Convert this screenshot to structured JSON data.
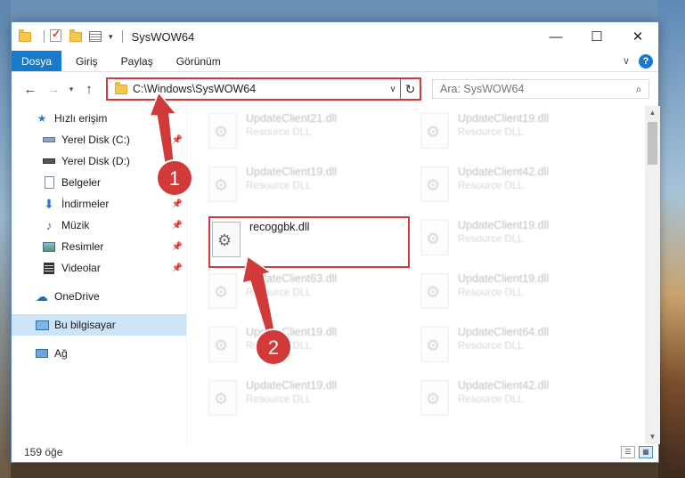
{
  "window": {
    "title": "SysWOW64",
    "minimize_glyph": "—",
    "maximize_glyph": "☐",
    "close_glyph": "✕"
  },
  "ribbon": {
    "file_tab": "Dosya",
    "tabs": [
      "Giriş",
      "Paylaş",
      "Görünüm"
    ],
    "help_glyph": "?"
  },
  "nav": {
    "back_glyph": "←",
    "forward_glyph": "→",
    "recent_glyph": "▾",
    "up_glyph": "↑",
    "address": "C:\\Windows\\SysWOW64",
    "refresh_glyph": "↻",
    "search_placeholder": "Ara: SysWOW64"
  },
  "sidebar": {
    "quick_access": "Hızlı erişim",
    "items": [
      {
        "label": "Yerel Disk (C:)",
        "icon": "drive-icon",
        "pinned": true
      },
      {
        "label": "Yerel Disk (D:)",
        "icon": "drive-icon",
        "pinned": false
      },
      {
        "label": "Belgeler",
        "icon": "documents-icon",
        "pinned": true
      },
      {
        "label": "İndirmeler",
        "icon": "downloads-icon",
        "pinned": true
      },
      {
        "label": "Müzik",
        "icon": "music-icon",
        "pinned": true
      },
      {
        "label": "Resimler",
        "icon": "pictures-icon",
        "pinned": true
      },
      {
        "label": "Videolar",
        "icon": "videos-icon",
        "pinned": true
      }
    ],
    "onedrive": "OneDrive",
    "this_pc": "Bu bilgisayar",
    "network": "Ağ"
  },
  "files": {
    "highlighted": {
      "name": "recoggbk.dll"
    },
    "left_column": [
      {
        "name": "UpdateClient21.dll",
        "type": "Resource DLL"
      },
      {
        "name": "UpdateClient19.dll",
        "type": "Resource DLL"
      },
      {
        "name": "UpdateClient63.dll",
        "type": "Resource DLL"
      },
      {
        "name": "UpdateClient19.dll",
        "type": "Resource DLL"
      },
      {
        "name": "UpdateClient19.dll",
        "type": "Resource DLL"
      }
    ],
    "right_column": [
      {
        "name": "UpdateClient19.dll",
        "type": "Resource DLL"
      },
      {
        "name": "UpdateClient42.dll",
        "type": "Resource DLL"
      },
      {
        "name": "UpdateClient19.dll",
        "type": "Resource DLL"
      },
      {
        "name": "UpdateClient19.dll",
        "type": "Resource DLL"
      },
      {
        "name": "UpdateClient64.dll",
        "type": "Resource DLL"
      },
      {
        "name": "UpdateClient42.dll",
        "type": "Resource DLL"
      }
    ]
  },
  "status": {
    "count": "159 öğe"
  },
  "annotations": {
    "marker_1": "1",
    "marker_2": "2",
    "color": "#d23a3a"
  }
}
